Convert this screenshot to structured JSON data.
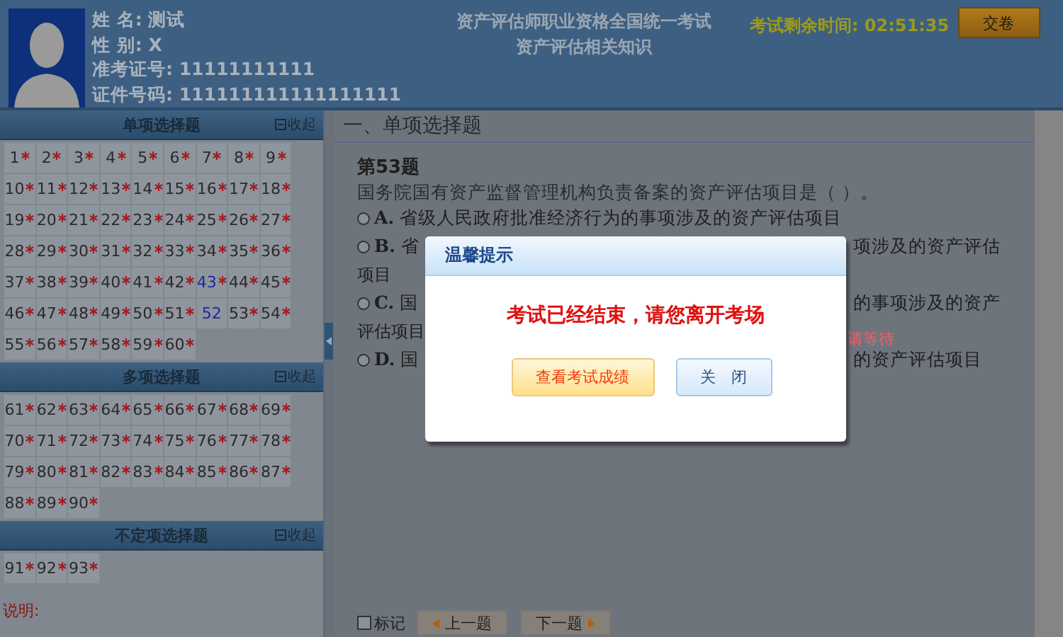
{
  "header": {
    "candidate": [
      {
        "label": "姓 名:",
        "value": "测试"
      },
      {
        "label": "性 别:",
        "value": "X"
      },
      {
        "label": "准考证号:",
        "value": "11111111111"
      },
      {
        "label": "证件号码:",
        "value": "111111111111111111"
      }
    ],
    "exam_title": "资产评估师职业资格全国统一考试",
    "subject": "资产评估相关知识",
    "timer_label": "考试剩余时间:",
    "timer_value": "02:51:35",
    "submit_button": "交卷"
  },
  "sidebar": {
    "sections": [
      {
        "title": "单项选择题",
        "collapse": "收起",
        "items": [
          {
            "number": "1",
            "unanswered": true,
            "current": false
          },
          {
            "number": "2",
            "unanswered": true,
            "current": false
          },
          {
            "number": "3",
            "unanswered": true,
            "current": false
          },
          {
            "number": "4",
            "unanswered": true,
            "current": false
          },
          {
            "number": "5",
            "unanswered": true,
            "current": false
          },
          {
            "number": "6",
            "unanswered": true,
            "current": false
          },
          {
            "number": "7",
            "unanswered": true,
            "current": false
          },
          {
            "number": "8",
            "unanswered": true,
            "current": false
          },
          {
            "number": "9",
            "unanswered": true,
            "current": false
          },
          {
            "number": "10",
            "unanswered": true,
            "current": false
          },
          {
            "number": "11",
            "unanswered": true,
            "current": false
          },
          {
            "number": "12",
            "unanswered": true,
            "current": false
          },
          {
            "number": "13",
            "unanswered": true,
            "current": false
          },
          {
            "number": "14",
            "unanswered": true,
            "current": false
          },
          {
            "number": "15",
            "unanswered": true,
            "current": false
          },
          {
            "number": "16",
            "unanswered": true,
            "current": false
          },
          {
            "number": "17",
            "unanswered": true,
            "current": false
          },
          {
            "number": "18",
            "unanswered": true,
            "current": false
          },
          {
            "number": "19",
            "unanswered": true,
            "current": false
          },
          {
            "number": "20",
            "unanswered": true,
            "current": false
          },
          {
            "number": "21",
            "unanswered": true,
            "current": false
          },
          {
            "number": "22",
            "unanswered": true,
            "current": false
          },
          {
            "number": "23",
            "unanswered": true,
            "current": false
          },
          {
            "number": "24",
            "unanswered": true,
            "current": false
          },
          {
            "number": "25",
            "unanswered": true,
            "current": false
          },
          {
            "number": "26",
            "unanswered": true,
            "current": false
          },
          {
            "number": "27",
            "unanswered": true,
            "current": false
          },
          {
            "number": "28",
            "unanswered": true,
            "current": false
          },
          {
            "number": "29",
            "unanswered": true,
            "current": false
          },
          {
            "number": "30",
            "unanswered": true,
            "current": false
          },
          {
            "number": "31",
            "unanswered": true,
            "current": false
          },
          {
            "number": "32",
            "unanswered": true,
            "current": false
          },
          {
            "number": "33",
            "unanswered": true,
            "current": false
          },
          {
            "number": "34",
            "unanswered": true,
            "current": false
          },
          {
            "number": "35",
            "unanswered": true,
            "current": false
          },
          {
            "number": "36",
            "unanswered": true,
            "current": false
          },
          {
            "number": "37",
            "unanswered": true,
            "current": false
          },
          {
            "number": "38",
            "unanswered": true,
            "current": false
          },
          {
            "number": "39",
            "unanswered": true,
            "current": false
          },
          {
            "number": "40",
            "unanswered": true,
            "current": false
          },
          {
            "number": "41",
            "unanswered": true,
            "current": false
          },
          {
            "number": "42",
            "unanswered": true,
            "current": false
          },
          {
            "number": "43",
            "unanswered": true,
            "current": true
          },
          {
            "number": "44",
            "unanswered": true,
            "current": false
          },
          {
            "number": "45",
            "unanswered": true,
            "current": false
          },
          {
            "number": "46",
            "unanswered": true,
            "current": false
          },
          {
            "number": "47",
            "unanswered": true,
            "current": false
          },
          {
            "number": "48",
            "unanswered": true,
            "current": false
          },
          {
            "number": "49",
            "unanswered": true,
            "current": false
          },
          {
            "number": "50",
            "unanswered": true,
            "current": false
          },
          {
            "number": "51",
            "unanswered": true,
            "current": false
          },
          {
            "number": "52",
            "unanswered": false,
            "current": true
          },
          {
            "number": "53",
            "unanswered": true,
            "current": false
          },
          {
            "number": "54",
            "unanswered": true,
            "current": false
          },
          {
            "number": "55",
            "unanswered": true,
            "current": false
          },
          {
            "number": "56",
            "unanswered": true,
            "current": false
          },
          {
            "number": "57",
            "unanswered": true,
            "current": false
          },
          {
            "number": "58",
            "unanswered": true,
            "current": false
          },
          {
            "number": "59",
            "unanswered": true,
            "current": false
          },
          {
            "number": "60",
            "unanswered": true,
            "current": false
          }
        ]
      },
      {
        "title": "多项选择题",
        "collapse": "收起",
        "items": [
          {
            "number": "61",
            "unanswered": true,
            "current": false
          },
          {
            "number": "62",
            "unanswered": true,
            "current": false
          },
          {
            "number": "63",
            "unanswered": true,
            "current": false
          },
          {
            "number": "64",
            "unanswered": true,
            "current": false
          },
          {
            "number": "65",
            "unanswered": true,
            "current": false
          },
          {
            "number": "66",
            "unanswered": true,
            "current": false
          },
          {
            "number": "67",
            "unanswered": true,
            "current": false
          },
          {
            "number": "68",
            "unanswered": true,
            "current": false
          },
          {
            "number": "69",
            "unanswered": true,
            "current": false
          },
          {
            "number": "70",
            "unanswered": true,
            "current": false
          },
          {
            "number": "71",
            "unanswered": true,
            "current": false
          },
          {
            "number": "72",
            "unanswered": true,
            "current": false
          },
          {
            "number": "73",
            "unanswered": true,
            "current": false
          },
          {
            "number": "74",
            "unanswered": true,
            "current": false
          },
          {
            "number": "75",
            "unanswered": true,
            "current": false
          },
          {
            "number": "76",
            "unanswered": true,
            "current": false
          },
          {
            "number": "77",
            "unanswered": true,
            "current": false
          },
          {
            "number": "78",
            "unanswered": true,
            "current": false
          },
          {
            "number": "79",
            "unanswered": true,
            "current": false
          },
          {
            "number": "80",
            "unanswered": true,
            "current": false
          },
          {
            "number": "81",
            "unanswered": true,
            "current": false
          },
          {
            "number": "82",
            "unanswered": true,
            "current": false
          },
          {
            "number": "83",
            "unanswered": true,
            "current": false
          },
          {
            "number": "84",
            "unanswered": true,
            "current": false
          },
          {
            "number": "85",
            "unanswered": true,
            "current": false
          },
          {
            "number": "86",
            "unanswered": true,
            "current": false
          },
          {
            "number": "87",
            "unanswered": true,
            "current": false
          },
          {
            "number": "88",
            "unanswered": true,
            "current": false
          },
          {
            "number": "89",
            "unanswered": true,
            "current": false
          },
          {
            "number": "90",
            "unanswered": true,
            "current": false
          }
        ]
      },
      {
        "title": "不定项选择题",
        "collapse": "收起",
        "items": [
          {
            "number": "91",
            "unanswered": true,
            "current": false
          },
          {
            "number": "92",
            "unanswered": true,
            "current": false
          },
          {
            "number": "93",
            "unanswered": true,
            "current": false
          }
        ]
      }
    ],
    "notes_title": "说明:"
  },
  "main": {
    "section_title": "一、单项选择题",
    "question_number": "第53题",
    "question": "国务院国有资产监督管理机构负责备案的资产评估项目是（   ）。",
    "options": [
      {
        "letter": "A.",
        "text": "省级人民政府批准经济行为的事项涉及的资产评估项目",
        "selected": false
      },
      {
        "letter": "B.",
        "text": "省",
        "hidden_text": "项涉及的资产评估",
        "continuation": "项目",
        "selected": false
      },
      {
        "letter": "C.",
        "text": "国",
        "hidden_text": "的事项涉及的资产",
        "continuation": "评估项目",
        "selected": false
      },
      {
        "letter": "D.",
        "text": "国",
        "hidden_text": "的资产评估项目",
        "selected": false
      }
    ],
    "waiting_note": "请等待",
    "mark_label": "标记",
    "mark_checked": false,
    "prev_button": "上一题",
    "next_button": "下一题"
  },
  "dialog": {
    "title": "温馨提示",
    "message": "考试已经结束，请您离开考场",
    "buttons": [
      {
        "label": "查看考试成绩",
        "kind": "primary"
      },
      {
        "label": "关　闭",
        "kind": "secondary"
      }
    ]
  }
}
